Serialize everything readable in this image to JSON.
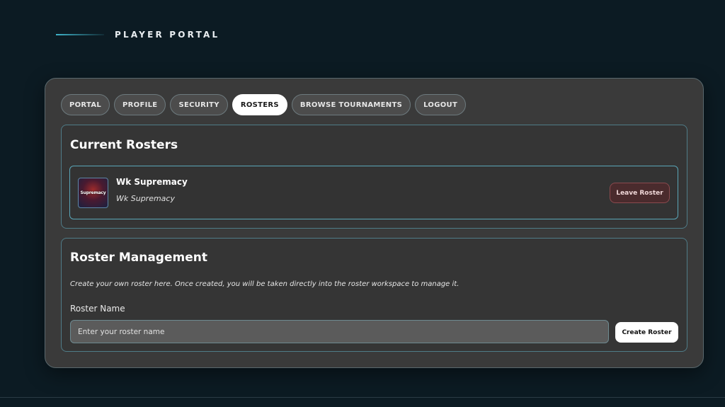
{
  "header": {
    "title": "PLAYER PORTAL"
  },
  "tabs": [
    {
      "label": "PORTAL",
      "active": false
    },
    {
      "label": "PROFILE",
      "active": false
    },
    {
      "label": "SECURITY",
      "active": false
    },
    {
      "label": "ROSTERS",
      "active": true
    },
    {
      "label": "BROWSE TOURNAMENTS",
      "active": false
    },
    {
      "label": "LOGOUT",
      "active": false
    }
  ],
  "current_rosters": {
    "title": "Current Rosters",
    "items": [
      {
        "name": "Wk Supremacy",
        "subtitle": "Wk Supremacy",
        "logo_text": "Supremacy",
        "action_label": "Leave Roster"
      }
    ]
  },
  "roster_management": {
    "title": "Roster Management",
    "description": "Create your own roster here. Once created, you will be taken directly into the roster workspace to manage it.",
    "field_label": "Roster Name",
    "input_placeholder": "Enter your roster name",
    "input_value": "",
    "create_label": "Create Roster"
  },
  "colors": {
    "background": "#0c1b23",
    "panel": "#3a3a3a",
    "accent": "#3fb3c9",
    "leave_button": "#4a2b2d"
  }
}
